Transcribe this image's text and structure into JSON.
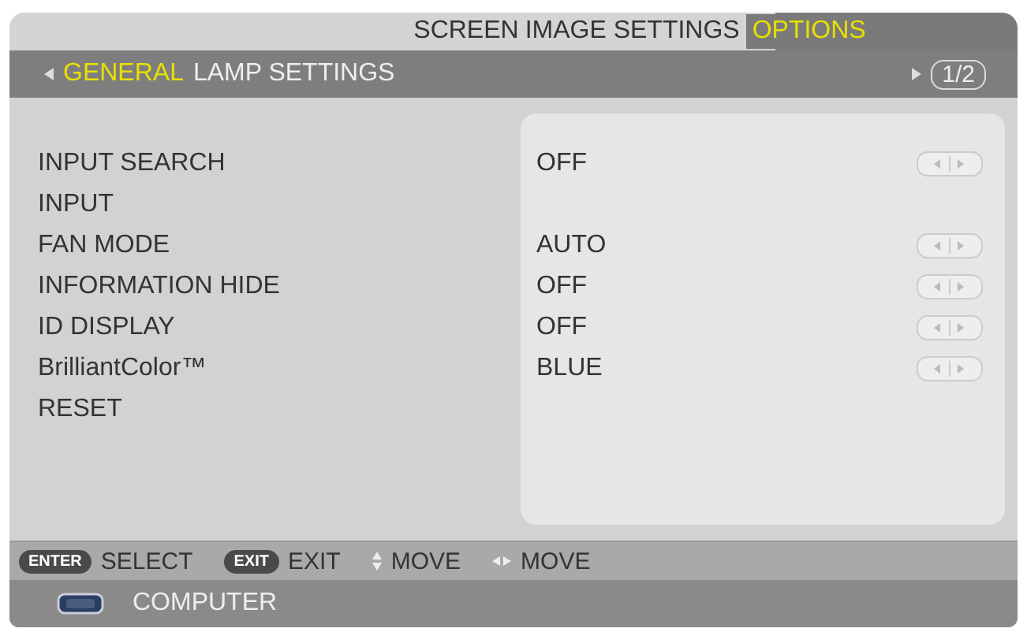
{
  "tabs": [
    {
      "label": "SCREEN",
      "selected": false
    },
    {
      "label": "IMAGE SETTINGS",
      "selected": false
    },
    {
      "label": "OPTIONS",
      "selected": true
    }
  ],
  "subtabs": [
    {
      "label": "GENERAL",
      "selected": true
    },
    {
      "label": "LAMP SETTINGS",
      "selected": false
    }
  ],
  "page": "1/2",
  "rows": [
    {
      "label": "INPUT SEARCH",
      "value": "OFF",
      "adjustable": true
    },
    {
      "label": "INPUT",
      "adjustable": false
    },
    {
      "label": "FAN MODE",
      "value": "AUTO",
      "adjustable": true
    },
    {
      "label": "INFORMATION HIDE",
      "value": "OFF",
      "adjustable": true
    },
    {
      "label": "ID DISPLAY",
      "value": "OFF",
      "adjustable": true
    },
    {
      "label": "BrilliantColor™",
      "value": "BLUE",
      "adjustable": true
    },
    {
      "label": "RESET",
      "adjustable": false
    }
  ],
  "hints": [
    {
      "kind": "key",
      "key": "ENTER",
      "label": "SELECT"
    },
    {
      "kind": "key",
      "key": "EXIT",
      "label": "EXIT"
    },
    {
      "kind": "updown",
      "label": "MOVE"
    },
    {
      "kind": "leftright",
      "label": "MOVE"
    }
  ],
  "source": "COMPUTER"
}
